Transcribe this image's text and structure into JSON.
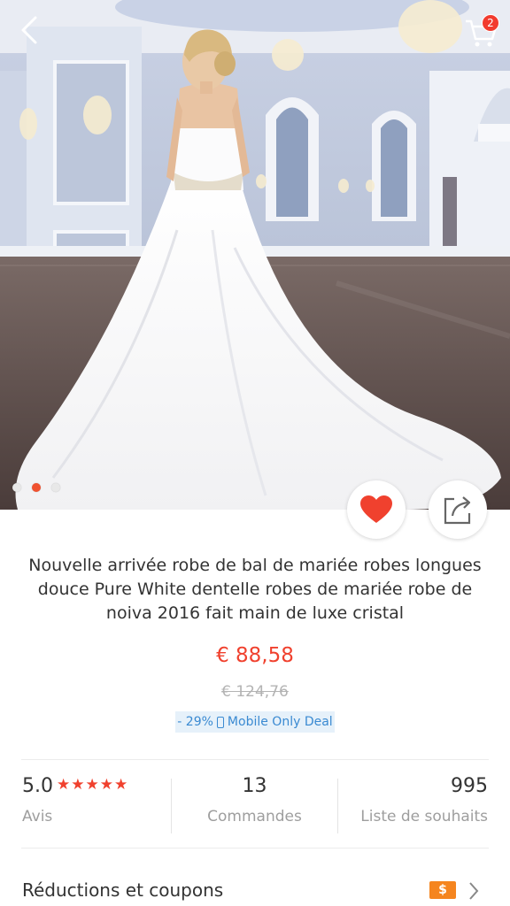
{
  "header": {
    "back_icon": "chevron-left-icon",
    "cart_icon": "shopping-cart-icon",
    "cart_count": "2"
  },
  "gallery": {
    "image_subject": "wedding-dress-photo",
    "total_images": 3,
    "active_index": 1
  },
  "actions": {
    "favorite_icon": "heart-icon",
    "share_icon": "share-icon"
  },
  "product": {
    "title": "Nouvelle arrivée robe de bal de mariée robes longues douce Pure White dentelle robes de mariée robe de noiva 2016 fait main de luxe cristal",
    "price": "€ 88,58",
    "original_price": "€ 124,76",
    "discount": "- 29%",
    "deal_label": "Mobile Only Deal"
  },
  "stats": {
    "rating": "5.0",
    "stars": "★★★★★",
    "rating_label": "Avis",
    "orders": "13",
    "orders_label": "Commandes",
    "wishlist": "995",
    "wishlist_label": "Liste de souhaits"
  },
  "coupons": {
    "label": "Réductions et coupons",
    "icon_text": "$"
  },
  "colors": {
    "accent": "#f0412e",
    "deal_bg": "#e6f1fa",
    "deal_text": "#3a8ad2",
    "coupon_icon": "#f5851f"
  }
}
